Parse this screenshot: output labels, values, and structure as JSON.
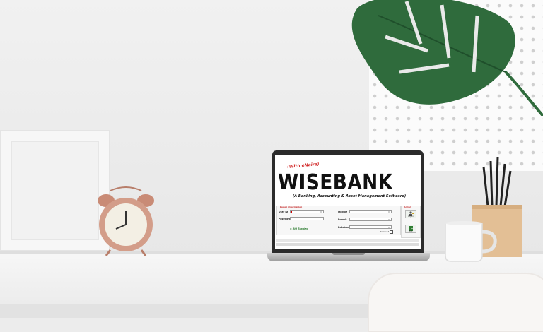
{
  "app": {
    "with_tag": "(With eNaira)",
    "title": "WISEBANK",
    "subtitle": "(A Banking, Accounting & Asset Management Software)"
  },
  "login_panel": {
    "title": "Logon Information",
    "user_id_label": "User ID",
    "user_id_value": "",
    "password_label": "Password",
    "password_value": "",
    "module_label": "Module",
    "module_value": "",
    "branch_label": "Branch",
    "branch_value": "",
    "database_label": "Database",
    "database_value": "",
    "secured_label": "Secured",
    "bio_label": "BIO Enabled"
  },
  "actions": {
    "title": "Action",
    "logon_label": "Logon",
    "exit_label": "Exit"
  },
  "colors": {
    "accent_red": "#d22b2b",
    "bio_green": "#2e7d32",
    "leaf": "#2f6b3c",
    "clock": "#cf9a87"
  }
}
